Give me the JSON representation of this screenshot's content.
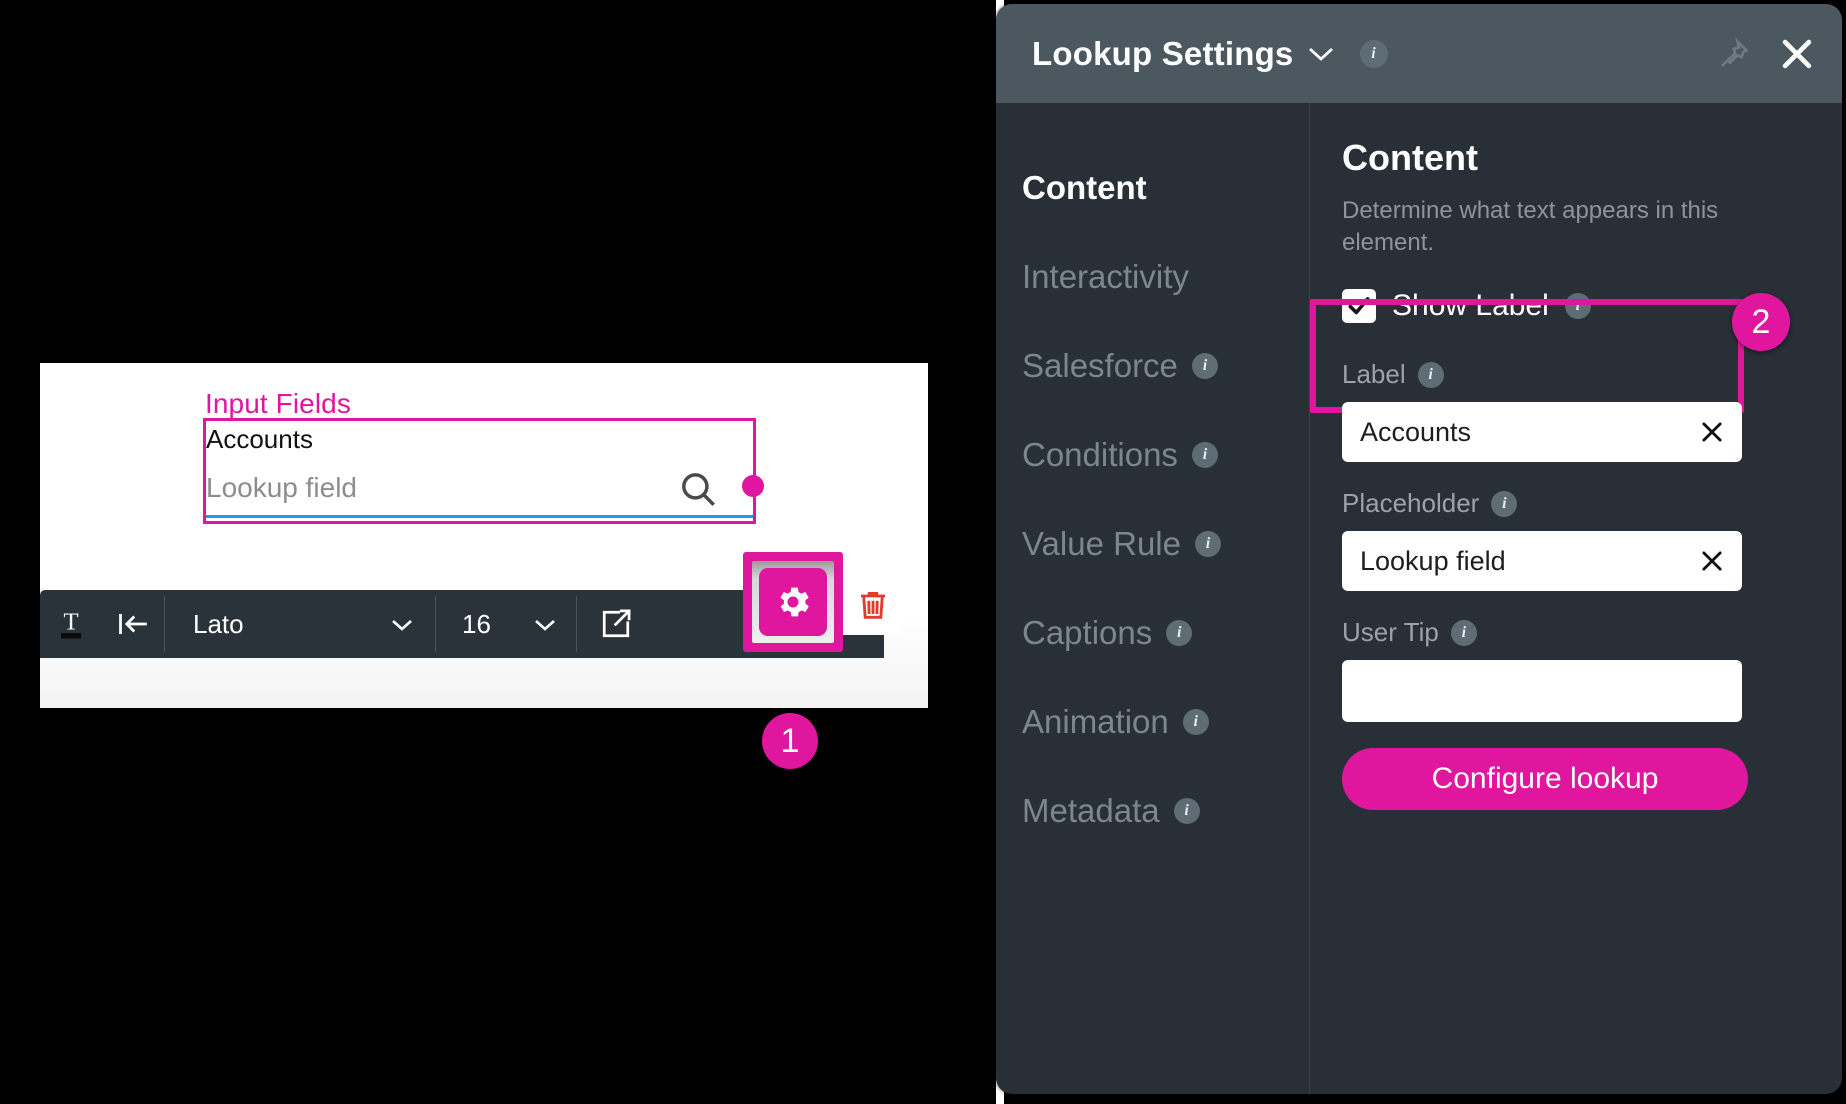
{
  "canvas": {
    "section_title": "Input Fields",
    "field_label": "Accounts",
    "field_placeholder": "Lookup field",
    "search_icon": "search-icon",
    "toolbar": {
      "text_style_icon": "text-format-icon",
      "indent_icon": "indent-left-icon",
      "font_family": "Lato",
      "font_size": "16",
      "open_external_icon": "open-external-icon",
      "settings_icon": "gear-icon",
      "delete_icon": "trash-icon"
    },
    "badge_1": "1"
  },
  "panel": {
    "title": "Lookup Settings",
    "title_chevron_icon": "chevron-down-icon",
    "header_info_icon": "info-icon",
    "pin_icon": "pin-icon",
    "close_icon": "close-icon",
    "badge_2": "2",
    "nav": [
      {
        "label": "Content",
        "info": false,
        "active": true
      },
      {
        "label": "Interactivity",
        "info": false,
        "active": false
      },
      {
        "label": "Salesforce",
        "info": true,
        "active": false
      },
      {
        "label": "Conditions",
        "info": true,
        "active": false
      },
      {
        "label": "Value Rule",
        "info": true,
        "active": false
      },
      {
        "label": "Captions",
        "info": true,
        "active": false
      },
      {
        "label": "Animation",
        "info": true,
        "active": false
      },
      {
        "label": "Metadata",
        "info": true,
        "active": false
      }
    ],
    "content": {
      "heading": "Content",
      "description": "Determine what text appears in this element.",
      "show_label_text": "Show Label",
      "show_label_checked": true,
      "fields": [
        {
          "label": "Label",
          "value": "Accounts",
          "placeholder": "",
          "clearable": true
        },
        {
          "label": "Placeholder",
          "value": "Lookup field",
          "placeholder": "",
          "clearable": true
        },
        {
          "label": "User Tip",
          "value": "",
          "placeholder": "",
          "clearable": false
        }
      ],
      "configure_button": "Configure lookup"
    }
  },
  "colors": {
    "accent": "#E0169E",
    "panel_body": "#292F36",
    "panel_header": "#4B5860",
    "toolbar": "#2B333A",
    "underline": "#2196F3",
    "trash": "#E23B2E"
  }
}
